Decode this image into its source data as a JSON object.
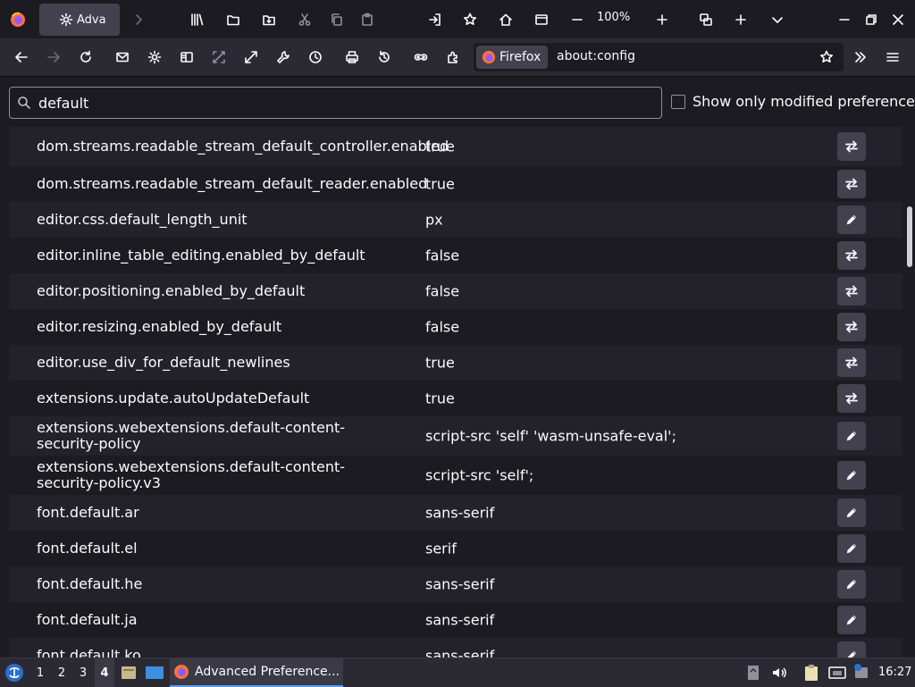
{
  "window": {
    "tab_title": "Advanced Preferences",
    "zoom": "100%"
  },
  "navbar": {
    "identity_label": "Firefox",
    "url": "about:config"
  },
  "search": {
    "value": "default",
    "show_modified_label": "Show only modified preferences"
  },
  "prefs": [
    {
      "name": "dom.streams.readable_stream_default_controller.enabled",
      "value": "true",
      "action": "toggle"
    },
    {
      "name": "dom.streams.readable_stream_default_reader.enabled",
      "value": "true",
      "action": "toggle"
    },
    {
      "name": "editor.css.default_length_unit",
      "value": "px",
      "action": "edit"
    },
    {
      "name": "editor.inline_table_editing.enabled_by_default",
      "value": "false",
      "action": "toggle"
    },
    {
      "name": "editor.positioning.enabled_by_default",
      "value": "false",
      "action": "toggle"
    },
    {
      "name": "editor.resizing.enabled_by_default",
      "value": "false",
      "action": "toggle"
    },
    {
      "name": "editor.use_div_for_default_newlines",
      "value": "true",
      "action": "toggle"
    },
    {
      "name": "extensions.update.autoUpdateDefault",
      "value": "true",
      "action": "toggle"
    },
    {
      "name": "extensions.webextensions.default-content-security-policy",
      "value": "script-src 'self' 'wasm-unsafe-eval';",
      "action": "edit"
    },
    {
      "name": "extensions.webextensions.default-content-security-policy.v3",
      "value": "script-src 'self';",
      "action": "edit"
    },
    {
      "name": "font.default.ar",
      "value": "sans-serif",
      "action": "edit"
    },
    {
      "name": "font.default.el",
      "value": "serif",
      "action": "edit"
    },
    {
      "name": "font.default.he",
      "value": "sans-serif",
      "action": "edit"
    },
    {
      "name": "font.default.ja",
      "value": "sans-serif",
      "action": "edit"
    },
    {
      "name": "font.default.ko",
      "value": "sans-serif",
      "action": "edit"
    }
  ],
  "taskbar": {
    "workspaces": [
      "1",
      "2",
      "3",
      "4"
    ],
    "active_workspace": "4",
    "task_label": "Advanced Preference...",
    "clock": "16:27"
  },
  "colors": {
    "background": "#1c1b22",
    "toolbar": "#2b2a33",
    "button": "#42414d",
    "accent": "#5aa0e6"
  }
}
